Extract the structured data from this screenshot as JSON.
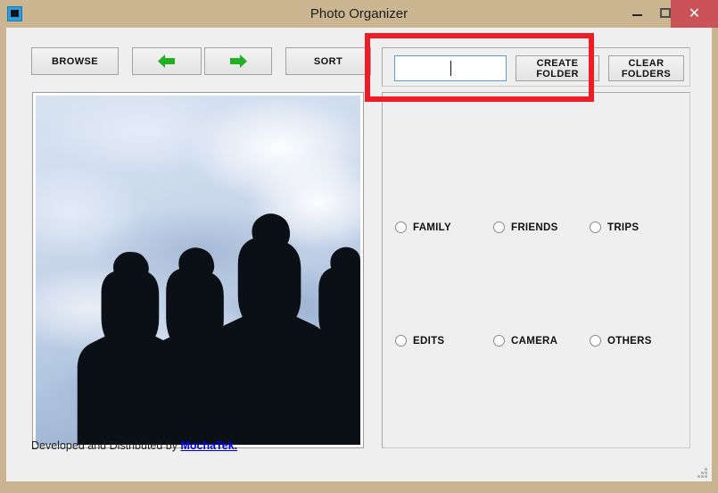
{
  "window": {
    "title": "Photo Organizer",
    "icon": "app-icon",
    "controls": {
      "minimize": "–",
      "maximize": "□",
      "close": "✕"
    }
  },
  "toolbar": {
    "browse_label": "BROWSE",
    "prev_label": "",
    "next_label": "",
    "sort_label": "SORT",
    "prev_icon": "arrow-left-icon",
    "next_icon": "arrow-right-icon",
    "arrow_color": "#22b022"
  },
  "folder_controls": {
    "input_value": "",
    "input_placeholder": "",
    "create_label": "CREATE FOLDER",
    "clear_label": "CLEAR FOLDERS",
    "input_focused": true,
    "focus_color": "#5a9fd4"
  },
  "preview": {
    "alt": "Silhouettes of four people against a cloudy sky",
    "sky_top_color": "#ccd9ec",
    "sky_bottom_color": "#9fb6d4",
    "silhouette_color": "#0b0f16"
  },
  "folders": {
    "options": [
      {
        "label": "FAMILY",
        "selected": false
      },
      {
        "label": "FRIENDS",
        "selected": false
      },
      {
        "label": "TRIPS",
        "selected": false
      },
      {
        "label": "EDITS",
        "selected": false
      },
      {
        "label": "CAMERA",
        "selected": false
      },
      {
        "label": "OTHERS",
        "selected": false
      }
    ]
  },
  "footer": {
    "credit_text": "Developed and Distributed by ",
    "link_text": "MochaTek.",
    "link_color": "#0000ee"
  },
  "annotation": {
    "highlight_color": "#ee1c25",
    "target": "folder-name-input-and-create-folder-button"
  },
  "theme": {
    "titlebar_color": "#cbb691",
    "close_button_color": "#cb5256",
    "client_background": "#efefef"
  }
}
